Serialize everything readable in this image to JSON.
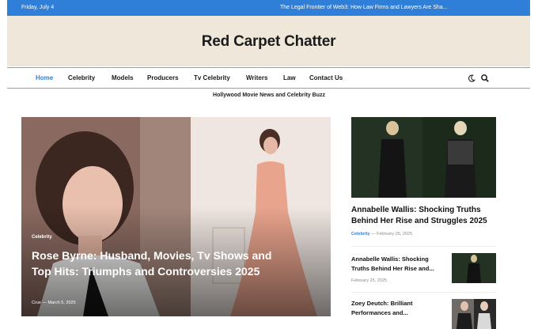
{
  "topbar": {
    "date": "Friday, July 4",
    "ticker": "The Legal Frontier of Web3: How Law Firms and Lawyers Are Sha..."
  },
  "site": {
    "title": "Red Carpet Chatter",
    "tagline": "Hollywood Movie News and Celebrity Buzz"
  },
  "nav": {
    "items": [
      "Home",
      "Celebrity",
      "Models",
      "Producers",
      "Tv Celebrity",
      "Writers",
      "Law",
      "Contact Us"
    ],
    "active": "Home",
    "icons": [
      "moon-icon",
      "search-icon"
    ]
  },
  "hero": {
    "category": "Celebrity",
    "title": "Rose Byrne: Husband, Movies, Tv Shows and Top Hits: Triumphs and Controversies 2025",
    "author": "Crue",
    "date": "March 5, 2025"
  },
  "sidebar": {
    "featured": {
      "title": "Annabelle Wallis: Shocking Truths Behind Her Rise and Struggles 2025",
      "category": "Celebrity",
      "date": "February 25, 2025"
    },
    "list": [
      {
        "title": "Annabelle Wallis: Shocking Truths Behind Her Rise and...",
        "date": "February 25, 2025"
      },
      {
        "title": "Zoey Deutch: Brilliant Performances and...",
        "date": ""
      }
    ]
  },
  "colors": {
    "accent": "#2f7fd8",
    "header_bg": "#efe7da",
    "nav_border": "#c57be0"
  }
}
